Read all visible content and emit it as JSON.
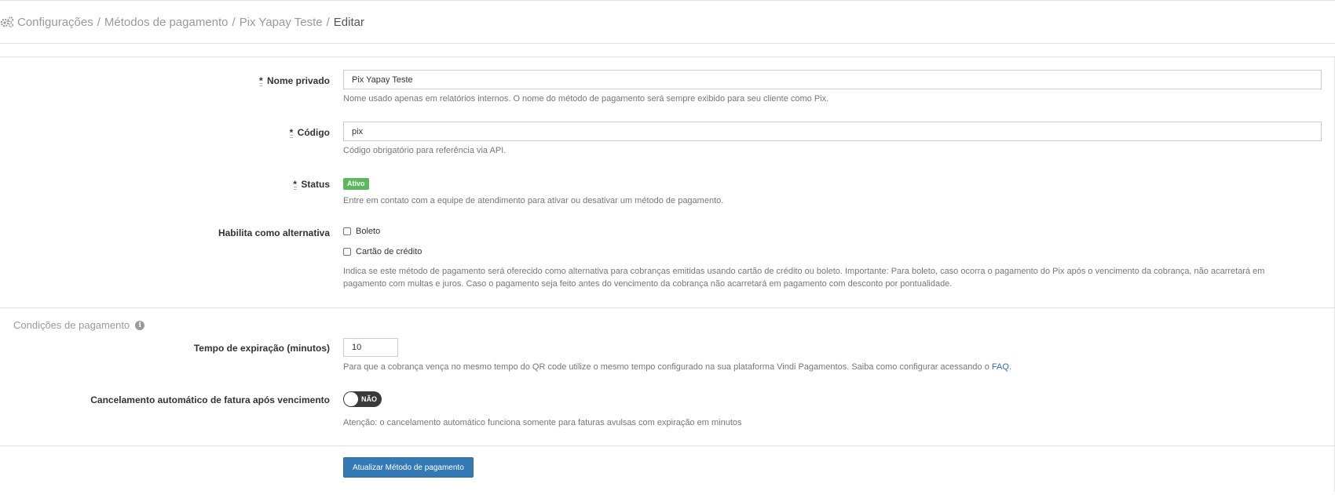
{
  "breadcrumb": {
    "items": [
      "Configurações",
      "Métodos de pagamento",
      "Pix Yapay Teste"
    ],
    "current": "Editar",
    "separator": "/"
  },
  "form": {
    "required_mark": "*",
    "nome_privado": {
      "label": "Nome privado",
      "value": "Pix Yapay Teste",
      "help": "Nome usado apenas em relatórios internos. O nome do método de pagamento será sempre exibido para seu cliente como Pix."
    },
    "codigo": {
      "label": "Código",
      "value": "pix",
      "help": "Código obrigatório para referência via API."
    },
    "status": {
      "label": "Status",
      "badge": "Ativo",
      "help": "Entre em contato com a equipe de atendimento para ativar ou desativar um método de pagamento."
    },
    "alternativa": {
      "label": "Habilita como alternativa",
      "options": [
        "Boleto",
        "Cartão de crédito"
      ],
      "help_line1": "Indica se este método de pagamento será oferecido como alternativa para cobranças emitidas usando cartão de crédito ou boleto. Importante: Para boleto, caso ocorra o pagamento do Pix após o vencimento da cobrança, não acarretará em",
      "help_line2": "pagamento com multas e juros. Caso o pagamento seja feito antes do vencimento da cobrança não acarretará em pagamento com desconto por pontualidade."
    }
  },
  "conditions": {
    "title": "Condições de pagamento",
    "info_icon": "i",
    "expiracao": {
      "label": "Tempo de expiração (minutos)",
      "value": "10",
      "help": "Para que a cobrança vença no mesmo tempo do QR code utilize o mesmo tempo configurado na sua plataforma Vindi Pagamentos. Saiba como configurar acessando o",
      "link": "FAQ",
      "help_end": "."
    },
    "cancelamento": {
      "label": "Cancelamento automático de fatura após vencimento",
      "toggle_label": "NÃO",
      "help": "Atenção: o cancelamento automático funciona somente para faturas avulsas com expiração em minutos"
    }
  },
  "submit_label": "Atualizar Método de pagamento",
  "colors": {
    "accent": "#337ab7",
    "success": "#5cb85c",
    "toggle_off": "#3a3a3a"
  }
}
